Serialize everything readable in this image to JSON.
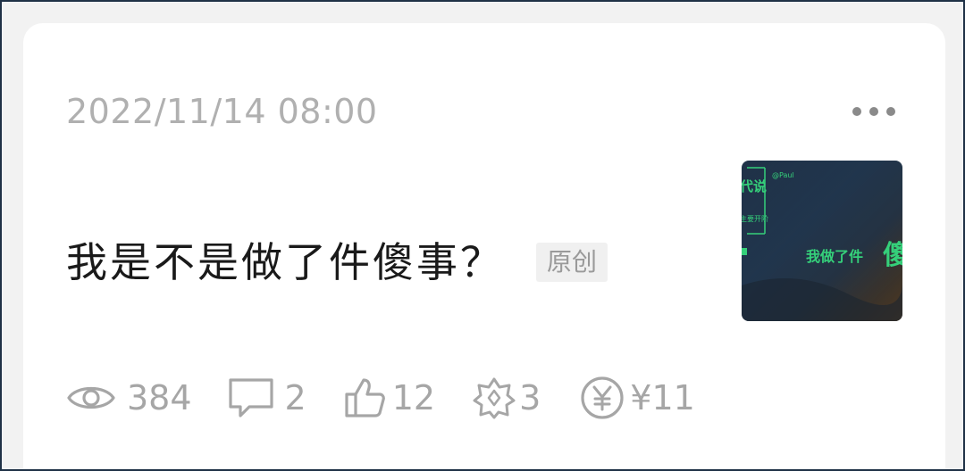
{
  "post": {
    "date": "2022/11/14 08:00",
    "title": "我是不是做了件傻事？",
    "badge": "原创",
    "thumbnail": {
      "text_top_right": "@Paul",
      "text_corner": "代说",
      "text_small": "主要开阶",
      "text_main": "我做了件",
      "text_big": "傻"
    }
  },
  "stats": {
    "views": "384",
    "comments": "2",
    "likes": "12",
    "shares": "3",
    "earnings": "¥11"
  },
  "icons": {
    "views": "eye-icon",
    "comments": "comment-icon",
    "likes": "thumbs-up-icon",
    "shares": "star-share-icon",
    "earnings": "yuan-coin-icon",
    "more": "more-dots-icon"
  },
  "colors": {
    "thumbnail_text": "#35d07a",
    "stat_gray": "#a6a6a6"
  }
}
